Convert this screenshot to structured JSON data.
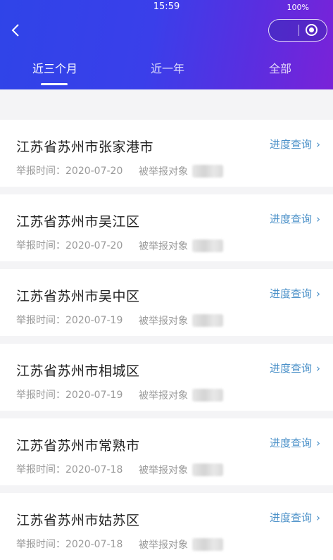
{
  "status_bar": {
    "time": "15:59",
    "battery": "100%"
  },
  "tabs": [
    {
      "label": "近三个月"
    },
    {
      "label": "近一年"
    },
    {
      "label": "全部"
    }
  ],
  "records": [
    {
      "location": "江苏省苏州市张家港市",
      "action": "进度查询",
      "time_label": "举报时间：2020-07-20",
      "target_label": "被举报对象"
    },
    {
      "location": "江苏省苏州市吴江区",
      "action": "进度查询",
      "time_label": "举报时间：2020-07-20",
      "target_label": "被举报对象"
    },
    {
      "location": "江苏省苏州市吴中区",
      "action": "进度查询",
      "time_label": "举报时间：2020-07-19",
      "target_label": "被举报对象"
    },
    {
      "location": "江苏省苏州市相城区",
      "action": "进度查询",
      "time_label": "举报时间：2020-07-19",
      "target_label": "被举报对象"
    },
    {
      "location": "江苏省苏州市常熟市",
      "action": "进度查询",
      "time_label": "举报时间：2020-07-18",
      "target_label": "被举报对象"
    },
    {
      "location": "江苏省苏州市姑苏区",
      "action": "进度查询",
      "time_label": "举报时间：2020-07-18",
      "target_label": "被举报对象"
    }
  ],
  "colors": {
    "header_start": "#2f44e8",
    "header_end": "#7a22d8",
    "link": "#4a90c8",
    "background": "#f4f4f6"
  },
  "icons": {
    "back": "chevron-left-icon",
    "close": "target-icon",
    "more": "more-icon",
    "link_arrow": "chevron-right-icon"
  }
}
